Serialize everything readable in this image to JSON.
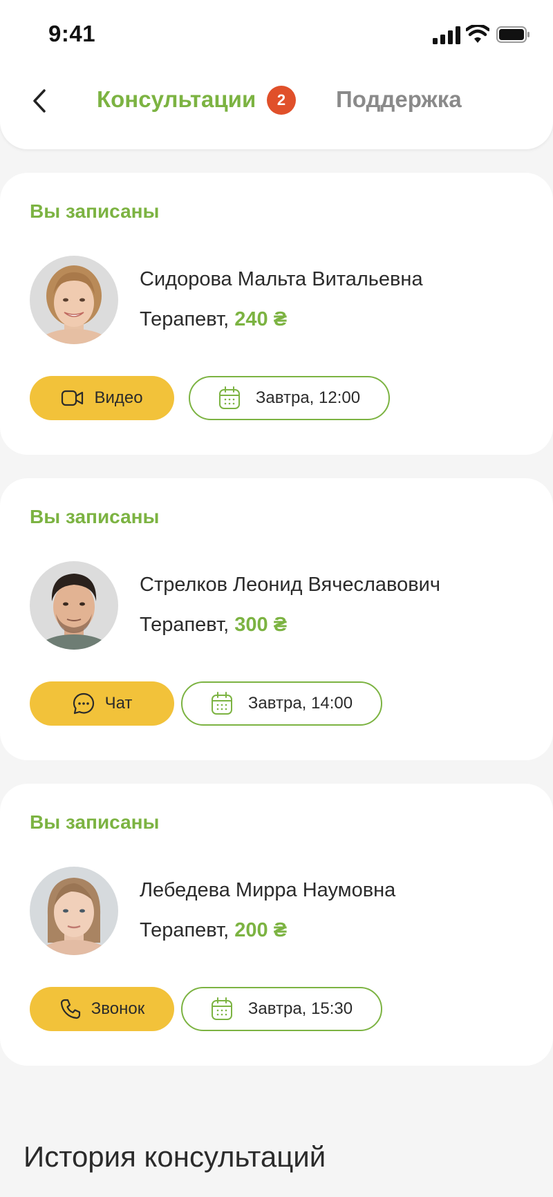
{
  "status_bar": {
    "time": "9:41"
  },
  "nav": {
    "tab_consultations": "Консультации",
    "consultations_badge": "2",
    "tab_support": "Поддержка"
  },
  "appointments": [
    {
      "status": "Вы записаны",
      "doctor_name": "Сидорова Мальта Витальевна",
      "role": "Терапевт,",
      "price": "240 ₴",
      "type_label": "Видео",
      "type_icon": "video-camera-icon",
      "date_label": "Завтра, 12:00",
      "avatar_style": "female-blond"
    },
    {
      "status": "Вы записаны",
      "doctor_name": "Стрелков Леонид Вячеславович",
      "role": "Терапевт,",
      "price": "300 ₴",
      "type_label": "Чат",
      "type_icon": "chat-bubble-icon",
      "date_label": "Завтра, 14:00",
      "avatar_style": "male-dark-hair"
    },
    {
      "status": "Вы записаны",
      "doctor_name": "Лебедева Мирра Наумовна",
      "role": "Терапевт,",
      "price": "200 ₴",
      "type_label": "Звонок",
      "type_icon": "phone-icon",
      "date_label": "Завтра, 15:30",
      "avatar_style": "female-light-brown"
    }
  ],
  "history": {
    "title": "История консультаций"
  },
  "colors": {
    "accent_green": "#7cb342",
    "accent_yellow": "#f2c23a",
    "badge_red": "#e0502a",
    "background": "#f5f5f5"
  }
}
